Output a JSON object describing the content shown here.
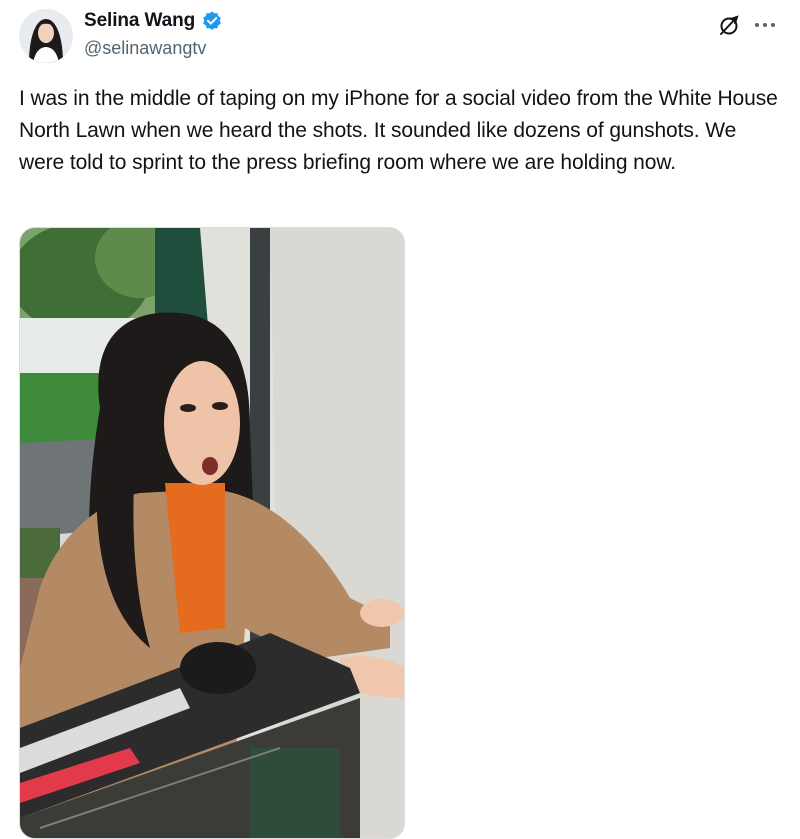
{
  "author": {
    "display_name": "Selina Wang",
    "handle": "@selinawangtv",
    "verified": true,
    "verified_color": "#1d9bf0"
  },
  "actions": {
    "grok_icon": "grok-icon",
    "more_icon": "more-dots-icon"
  },
  "tweet": {
    "text": "I was in the middle of taping on my iPhone for a social video from the White House North Lawn when we heard the shots. It sounded like dozens of gunshots. We were told to sprint to the press briefing room where we are holding now."
  },
  "media": {
    "type": "video-still",
    "icon": "media-photo"
  }
}
